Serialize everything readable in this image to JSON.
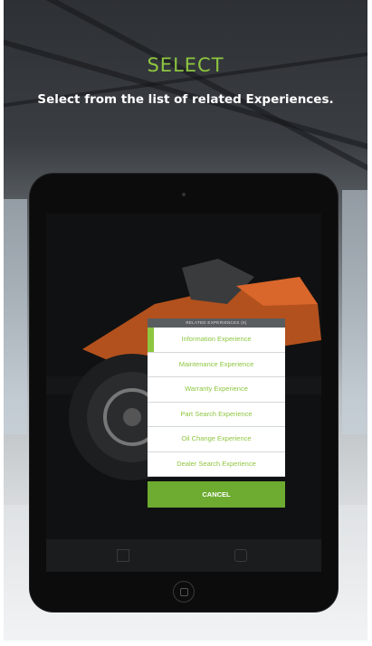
{
  "header": {
    "title": "SELECT",
    "subtitle": "Select from the list of related Experiences."
  },
  "modal": {
    "header_label": "RELATED EXPERIENCES (6)",
    "items": [
      {
        "label": "Information Experience",
        "active": true
      },
      {
        "label": "Maintenance Experience",
        "active": false
      },
      {
        "label": "Warranty Experience",
        "active": false
      },
      {
        "label": "Part Search Experience",
        "active": false
      },
      {
        "label": "Oil Change Experience",
        "active": false
      },
      {
        "label": "Dealer Search Experience",
        "active": false
      }
    ],
    "cancel_label": "CANCEL"
  },
  "colors": {
    "accent": "#8dc63f",
    "cancel_button": "#6dab31",
    "modal_header": "#5a5d60",
    "motorcycle": "#c4591f"
  },
  "icons": [
    "home-button-icon",
    "bottom-bar-left-icon",
    "bottom-bar-right-icon",
    "camera-icon"
  ]
}
